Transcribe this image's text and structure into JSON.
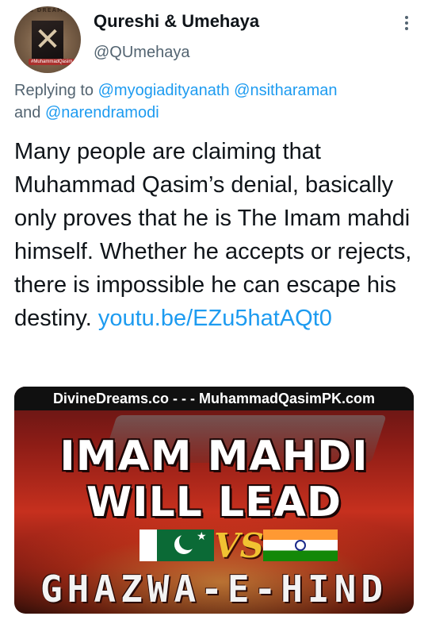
{
  "author": {
    "display_name": "Qureshi & Umehaya",
    "handle": "@QUmehaya",
    "avatar_top_text": "'S DREAMS",
    "avatar_tag": "#MuhammadQasim"
  },
  "reply": {
    "prefix": "Replying to ",
    "mentions": [
      "@myogiadityanath",
      "@nsitharaman",
      "@narendramodi"
    ],
    "conjunction": "and "
  },
  "tweet": {
    "text": "Many people are claiming that Muhammad Qasim’s denial, basically only proves that he is The Imam mahdi himself. Whether he accepts or rejects, there is impossible he can escape his destiny. ",
    "link": "youtu.be/EZu5hatAQt0"
  },
  "media": {
    "header": "DivineDreams.co - - - MuhammadQasimPK.com",
    "headline_1": "IMAM MAHDI",
    "headline_2": "WILL LEAD",
    "vs": "VS",
    "bottom": "GHAZWA-E-HIND"
  },
  "colors": {
    "link": "#1d9bf0",
    "secondary": "#536471",
    "text": "#0f1419"
  }
}
